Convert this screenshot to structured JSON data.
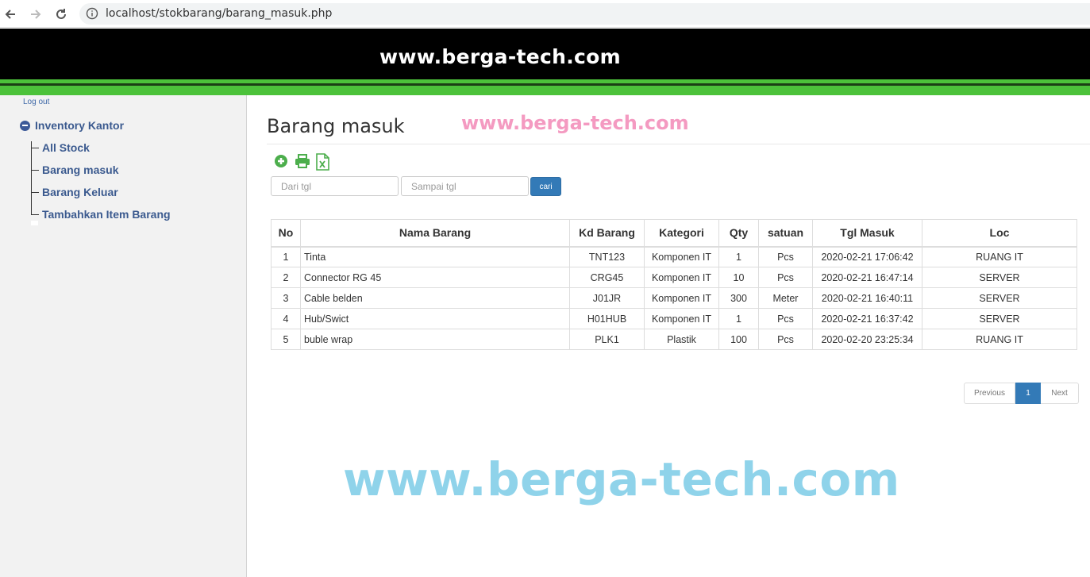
{
  "browser": {
    "url": "localhost/stokbarang/barang_masuk.php"
  },
  "header": {
    "title": "www.berga-tech.com"
  },
  "sidebar": {
    "logout": "Log out",
    "root": "Inventory Kantor",
    "items": [
      {
        "label": "All Stock"
      },
      {
        "label": "Barang masuk"
      },
      {
        "label": "Barang Keluar"
      },
      {
        "label": "Tambahkan Item Barang"
      }
    ]
  },
  "main": {
    "title": "Barang masuk",
    "watermark_small": "www.berga-tech.com",
    "watermark_big": "www.berga-tech.com",
    "filters": {
      "from_placeholder": "Dari tgl",
      "to_placeholder": "Sampai tgl",
      "search_label": "cari"
    }
  },
  "table": {
    "columns": [
      "No",
      "Nama Barang",
      "Kd Barang",
      "Kategori",
      "Qty",
      "satuan",
      "Tgl Masuk",
      "Loc"
    ],
    "rows": [
      [
        "1",
        "Tinta",
        "TNT123",
        "Komponen IT",
        "1",
        "Pcs",
        "2020-02-21 17:06:42",
        "RUANG IT"
      ],
      [
        "2",
        "Connector RG 45",
        "CRG45",
        "Komponen IT",
        "10",
        "Pcs",
        "2020-02-21 16:47:14",
        "SERVER"
      ],
      [
        "3",
        "Cable belden",
        "J01JR",
        "Komponen IT",
        "300",
        "Meter",
        "2020-02-21 16:40:11",
        "SERVER"
      ],
      [
        "4",
        "Hub/Swict",
        "H01HUB",
        "Komponen IT",
        "1",
        "Pcs",
        "2020-02-21 16:37:42",
        "SERVER"
      ],
      [
        "5",
        "buble wrap",
        "PLK1",
        "Plastik",
        "100",
        "Pcs",
        "2020-02-20 23:25:34",
        "RUANG IT"
      ]
    ]
  },
  "pagination": {
    "previous": "Previous",
    "current": "1",
    "next": "Next"
  },
  "colors": {
    "header_bg": "#000000",
    "stripe_green": "#4cc23a",
    "link_blue": "#3b5a8f",
    "primary": "#337ab7",
    "icon_green": "#5cb85c"
  }
}
